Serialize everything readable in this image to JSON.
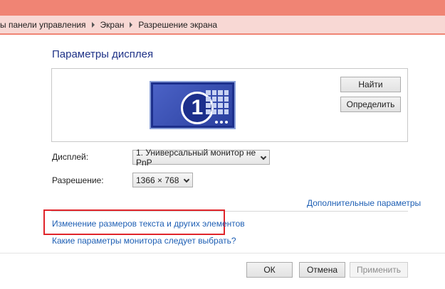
{
  "breadcrumb": {
    "items": [
      "ы панели управления",
      "Экран",
      "Разрешение экрана"
    ]
  },
  "section_title": "Параметры дисплея",
  "monitor": {
    "number": "1",
    "icon": "monitor-icon"
  },
  "buttons": {
    "find": "Найти",
    "detect": "Определить",
    "ok": "ОК",
    "cancel": "Отмена",
    "apply": "Применить"
  },
  "display": {
    "label": "Дисплей:",
    "value": "1. Универсальный монитор не PnP"
  },
  "resolution": {
    "label": "Разрешение:",
    "value": "1366 × 768"
  },
  "links": {
    "advanced": "Дополнительные параметры",
    "resize_text": "Изменение размеров текста и других элементов",
    "which_settings": "Какие параметры монитора следует выбрать?"
  },
  "colors": {
    "titlebar": "#f08474",
    "addressbar": "#f8d8d4",
    "link": "#1e5fb4",
    "highlight": "#e0242a",
    "section_title": "#1e3287"
  }
}
